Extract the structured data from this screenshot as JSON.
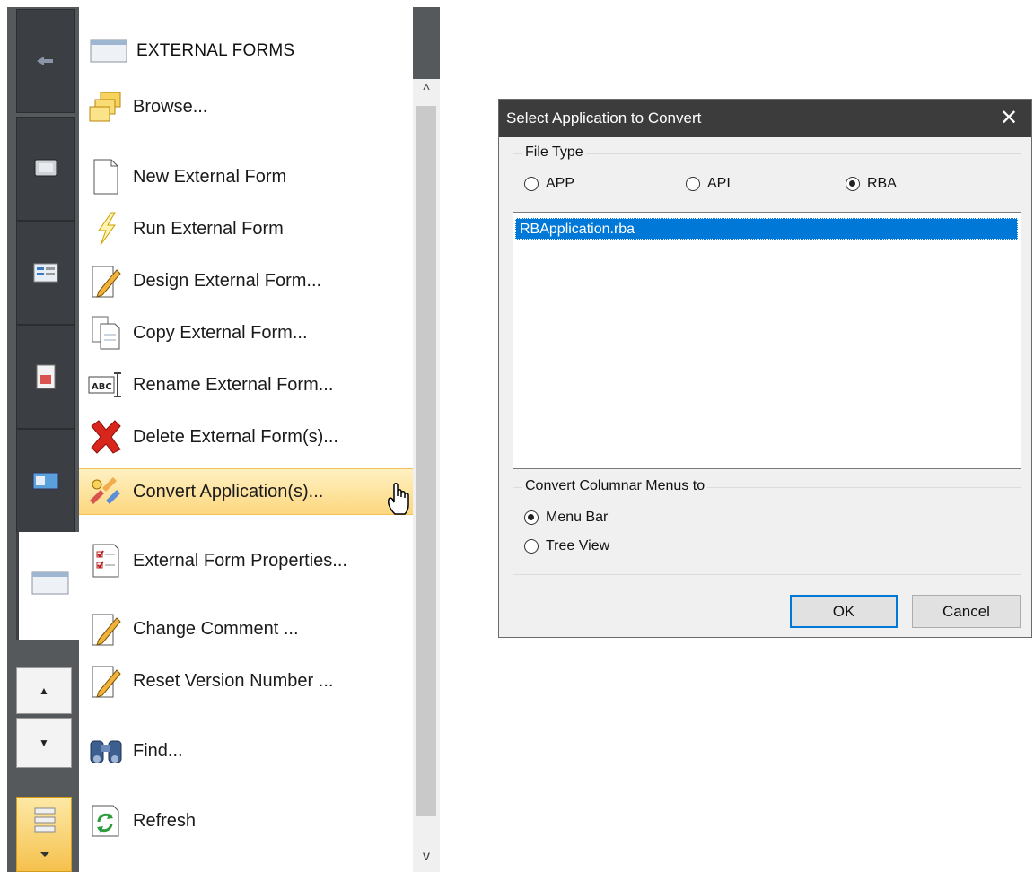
{
  "panel": {
    "header_title": "EXTERNAL FORMS",
    "menu_items": [
      {
        "label": "Browse...",
        "icon": "folders-icon"
      },
      {
        "label": "New External Form",
        "icon": "new-document-icon"
      },
      {
        "label": "Run External Form",
        "icon": "lightning-icon"
      },
      {
        "label": "Design External Form...",
        "icon": "pencil-document-icon"
      },
      {
        "label": "Copy External Form...",
        "icon": "copy-document-icon"
      },
      {
        "label": "Rename External Form...",
        "icon": "rename-abc-icon"
      },
      {
        "label": "Delete External Form(s)...",
        "icon": "red-x-icon"
      },
      {
        "label": "Convert Application(s)...",
        "icon": "convert-arrows-icon"
      },
      {
        "label": "External Form Properties...",
        "icon": "checklist-icon"
      },
      {
        "label": "Change Comment ...",
        "icon": "pencil-document-icon"
      },
      {
        "label": "Reset Version Number ...",
        "icon": "pencil-document-icon"
      },
      {
        "label": "Find...",
        "icon": "binoculars-icon"
      },
      {
        "label": "Refresh",
        "icon": "refresh-icon"
      }
    ],
    "hovered_item": "Convert Application(s)...",
    "scroll_up": "▲",
    "scroll_down": "▼",
    "menu_scroll_up": "^",
    "menu_scroll_down": "v"
  },
  "dialog": {
    "title": "Select Application to Convert",
    "close": "✕",
    "file_type": {
      "legend": "File Type",
      "options": [
        "APP",
        "API",
        "RBA"
      ],
      "selected": "RBA"
    },
    "files": [
      "RBApplication.rba"
    ],
    "selected_file": "RBApplication.rba",
    "convert_menus": {
      "legend": "Convert Columnar Menus to",
      "options": [
        "Menu Bar",
        "Tree View"
      ],
      "selected": "Menu Bar"
    },
    "ok_label": "OK",
    "cancel_label": "Cancel"
  },
  "colors": {
    "selection_blue": "#0078d7",
    "hover_gold": "#fcd77f",
    "titlebar": "#3c3c3c"
  }
}
